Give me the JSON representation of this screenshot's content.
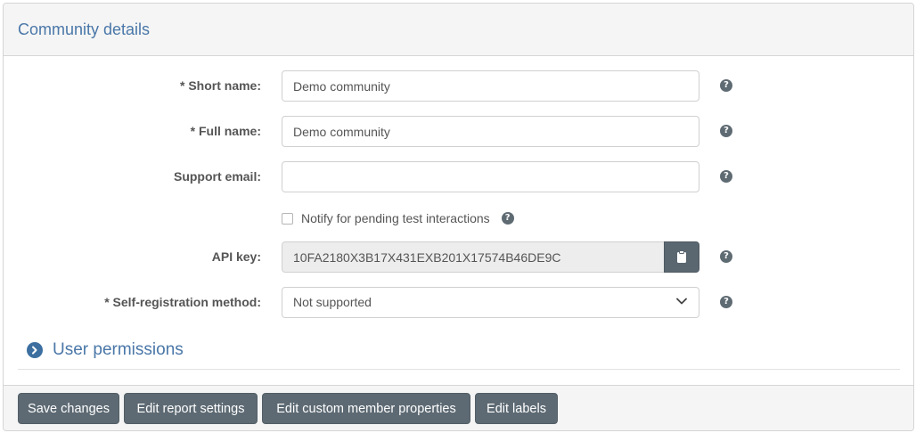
{
  "panel": {
    "title": "Community details"
  },
  "form": {
    "short_name": {
      "label": "* Short name:",
      "value": "Demo community"
    },
    "full_name": {
      "label": "* Full name:",
      "value": "Demo community"
    },
    "support_email": {
      "label": "Support email:",
      "value": ""
    },
    "notify": {
      "label": "Notify for pending test interactions",
      "checked": false
    },
    "api_key": {
      "label": "API key:",
      "value": "10FA2180X3B17X431EXB201X17574B46DE9C"
    },
    "self_registration": {
      "label": "* Self-registration method:",
      "value": "Not supported"
    },
    "help_glyph": "?"
  },
  "user_permissions": {
    "label": "User permissions"
  },
  "footer": {
    "buttons": [
      {
        "label": "Save changes"
      },
      {
        "label": "Edit report settings"
      },
      {
        "label": "Edit custom member properties"
      },
      {
        "label": "Edit labels"
      }
    ]
  },
  "icons": {
    "help": "question-circle-icon",
    "copy": "clipboard-icon",
    "select": "chevron-down-icon",
    "toggle": "chevron-right-circle-icon"
  },
  "colors": {
    "accent_text": "#4a77a8",
    "button_bg": "#5d6a73",
    "header_bg": "#f5f5f5"
  }
}
